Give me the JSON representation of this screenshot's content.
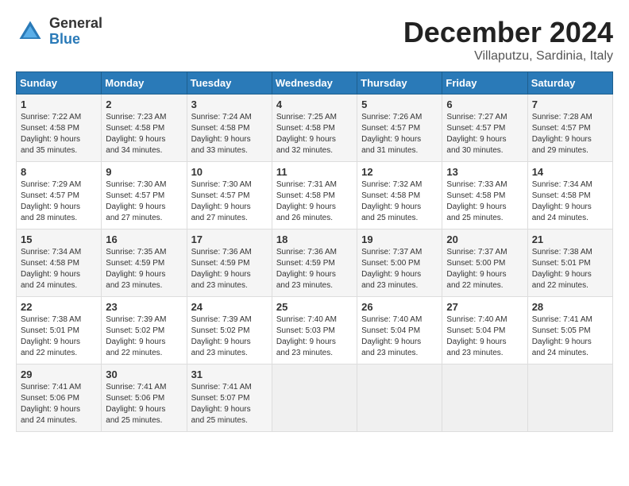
{
  "logo": {
    "general": "General",
    "blue": "Blue"
  },
  "title": "December 2024",
  "subtitle": "Villaputzu, Sardinia, Italy",
  "weekdays": [
    "Sunday",
    "Monday",
    "Tuesday",
    "Wednesday",
    "Thursday",
    "Friday",
    "Saturday"
  ],
  "weeks": [
    [
      {
        "day": "1",
        "info": "Sunrise: 7:22 AM\nSunset: 4:58 PM\nDaylight: 9 hours\nand 35 minutes."
      },
      {
        "day": "2",
        "info": "Sunrise: 7:23 AM\nSunset: 4:58 PM\nDaylight: 9 hours\nand 34 minutes."
      },
      {
        "day": "3",
        "info": "Sunrise: 7:24 AM\nSunset: 4:58 PM\nDaylight: 9 hours\nand 33 minutes."
      },
      {
        "day": "4",
        "info": "Sunrise: 7:25 AM\nSunset: 4:58 PM\nDaylight: 9 hours\nand 32 minutes."
      },
      {
        "day": "5",
        "info": "Sunrise: 7:26 AM\nSunset: 4:57 PM\nDaylight: 9 hours\nand 31 minutes."
      },
      {
        "day": "6",
        "info": "Sunrise: 7:27 AM\nSunset: 4:57 PM\nDaylight: 9 hours\nand 30 minutes."
      },
      {
        "day": "7",
        "info": "Sunrise: 7:28 AM\nSunset: 4:57 PM\nDaylight: 9 hours\nand 29 minutes."
      }
    ],
    [
      {
        "day": "8",
        "info": "Sunrise: 7:29 AM\nSunset: 4:57 PM\nDaylight: 9 hours\nand 28 minutes."
      },
      {
        "day": "9",
        "info": "Sunrise: 7:30 AM\nSunset: 4:57 PM\nDaylight: 9 hours\nand 27 minutes."
      },
      {
        "day": "10",
        "info": "Sunrise: 7:30 AM\nSunset: 4:57 PM\nDaylight: 9 hours\nand 27 minutes."
      },
      {
        "day": "11",
        "info": "Sunrise: 7:31 AM\nSunset: 4:58 PM\nDaylight: 9 hours\nand 26 minutes."
      },
      {
        "day": "12",
        "info": "Sunrise: 7:32 AM\nSunset: 4:58 PM\nDaylight: 9 hours\nand 25 minutes."
      },
      {
        "day": "13",
        "info": "Sunrise: 7:33 AM\nSunset: 4:58 PM\nDaylight: 9 hours\nand 25 minutes."
      },
      {
        "day": "14",
        "info": "Sunrise: 7:34 AM\nSunset: 4:58 PM\nDaylight: 9 hours\nand 24 minutes."
      }
    ],
    [
      {
        "day": "15",
        "info": "Sunrise: 7:34 AM\nSunset: 4:58 PM\nDaylight: 9 hours\nand 24 minutes."
      },
      {
        "day": "16",
        "info": "Sunrise: 7:35 AM\nSunset: 4:59 PM\nDaylight: 9 hours\nand 23 minutes."
      },
      {
        "day": "17",
        "info": "Sunrise: 7:36 AM\nSunset: 4:59 PM\nDaylight: 9 hours\nand 23 minutes."
      },
      {
        "day": "18",
        "info": "Sunrise: 7:36 AM\nSunset: 4:59 PM\nDaylight: 9 hours\nand 23 minutes."
      },
      {
        "day": "19",
        "info": "Sunrise: 7:37 AM\nSunset: 5:00 PM\nDaylight: 9 hours\nand 23 minutes."
      },
      {
        "day": "20",
        "info": "Sunrise: 7:37 AM\nSunset: 5:00 PM\nDaylight: 9 hours\nand 22 minutes."
      },
      {
        "day": "21",
        "info": "Sunrise: 7:38 AM\nSunset: 5:01 PM\nDaylight: 9 hours\nand 22 minutes."
      }
    ],
    [
      {
        "day": "22",
        "info": "Sunrise: 7:38 AM\nSunset: 5:01 PM\nDaylight: 9 hours\nand 22 minutes."
      },
      {
        "day": "23",
        "info": "Sunrise: 7:39 AM\nSunset: 5:02 PM\nDaylight: 9 hours\nand 22 minutes."
      },
      {
        "day": "24",
        "info": "Sunrise: 7:39 AM\nSunset: 5:02 PM\nDaylight: 9 hours\nand 23 minutes."
      },
      {
        "day": "25",
        "info": "Sunrise: 7:40 AM\nSunset: 5:03 PM\nDaylight: 9 hours\nand 23 minutes."
      },
      {
        "day": "26",
        "info": "Sunrise: 7:40 AM\nSunset: 5:04 PM\nDaylight: 9 hours\nand 23 minutes."
      },
      {
        "day": "27",
        "info": "Sunrise: 7:40 AM\nSunset: 5:04 PM\nDaylight: 9 hours\nand 23 minutes."
      },
      {
        "day": "28",
        "info": "Sunrise: 7:41 AM\nSunset: 5:05 PM\nDaylight: 9 hours\nand 24 minutes."
      }
    ],
    [
      {
        "day": "29",
        "info": "Sunrise: 7:41 AM\nSunset: 5:06 PM\nDaylight: 9 hours\nand 24 minutes."
      },
      {
        "day": "30",
        "info": "Sunrise: 7:41 AM\nSunset: 5:06 PM\nDaylight: 9 hours\nand 25 minutes."
      },
      {
        "day": "31",
        "info": "Sunrise: 7:41 AM\nSunset: 5:07 PM\nDaylight: 9 hours\nand 25 minutes."
      },
      {
        "day": "",
        "info": ""
      },
      {
        "day": "",
        "info": ""
      },
      {
        "day": "",
        "info": ""
      },
      {
        "day": "",
        "info": ""
      }
    ]
  ]
}
